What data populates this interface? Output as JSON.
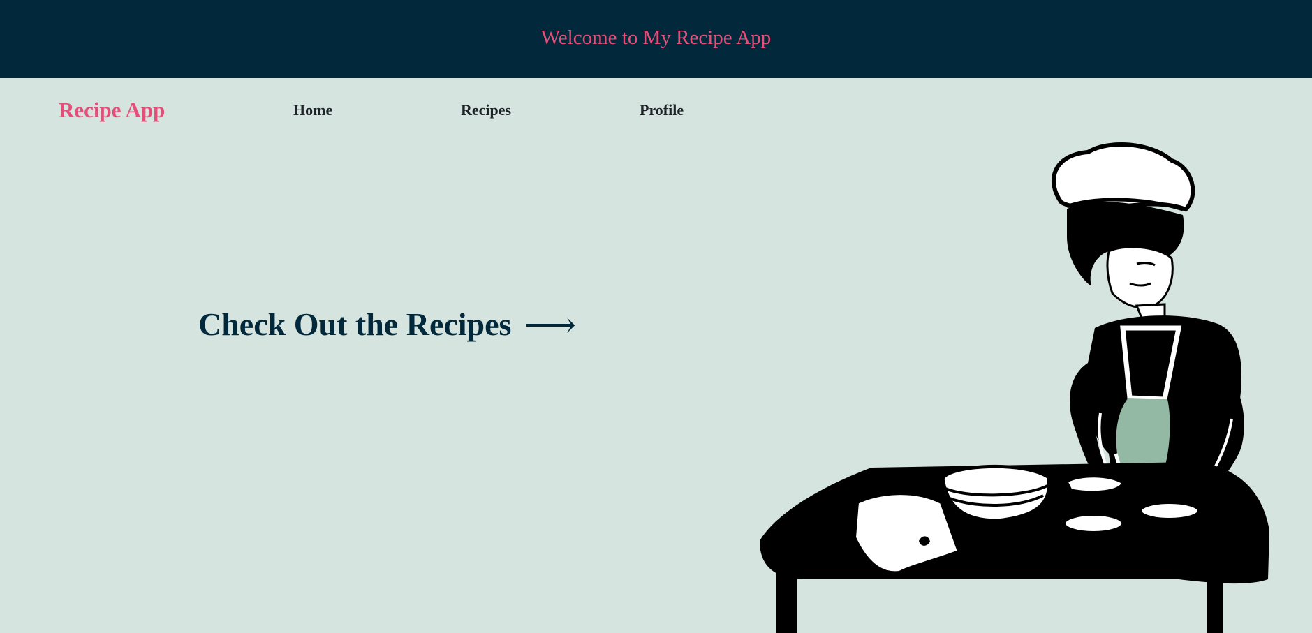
{
  "header": {
    "welcome": "Welcome to My Recipe App",
    "background": "#02283b",
    "text_color": "#e34f78"
  },
  "nav": {
    "brand": "Recipe App",
    "links": [
      {
        "label": "Home"
      },
      {
        "label": "Recipes"
      },
      {
        "label": "Profile"
      }
    ]
  },
  "hero": {
    "cta_label": "Check Out the Recipes",
    "cta_arrow": "⟶",
    "background": "#d5e4df",
    "illustration": "chef-illustration"
  },
  "colors": {
    "accent": "#e34f78",
    "dark": "#02283b",
    "apron": "#93b8a4"
  }
}
